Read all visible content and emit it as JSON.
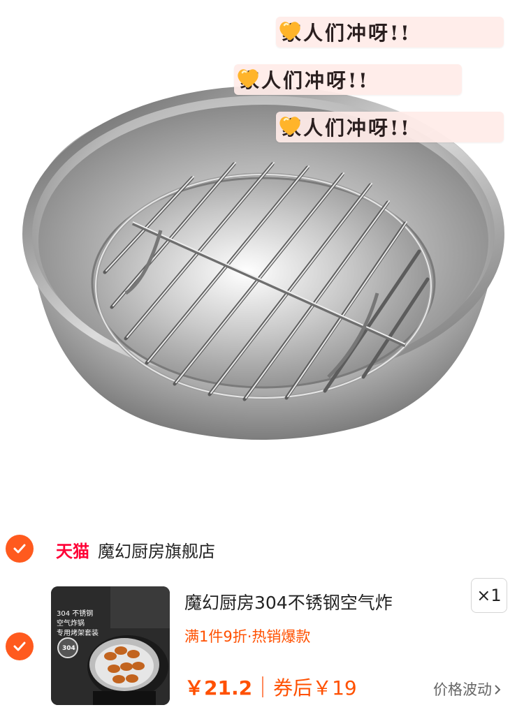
{
  "hero": {
    "image": "stainless-steel-air-fryer-tray-with-rack",
    "bubbles": [
      {
        "text": "家人们冲呀!!",
        "icon": "heart-icon"
      },
      {
        "text": "家人们冲呀!!",
        "icon": "heart-icon"
      },
      {
        "text": "家人们冲呀!!",
        "icon": "heart-icon"
      }
    ]
  },
  "store": {
    "badge": "天猫",
    "name": "魔幻厨房旗舰店",
    "checked": true
  },
  "item": {
    "checked": true,
    "title": "魔幻厨房304不锈钢空气炸",
    "promo": "满1件9折·热销爆款",
    "quantity": "×1",
    "price": "￥21.2",
    "after_coupon": "券后￥19",
    "price_fluctuation": "价格波动",
    "thumb_tags": [
      "304 不锈钢",
      "空气炸锅",
      "专用烤架套装"
    ],
    "thumb_badge": "304"
  },
  "colors": {
    "accent": "#ff5000",
    "check": "#ff5a1e",
    "tmall": "#ff0036"
  }
}
